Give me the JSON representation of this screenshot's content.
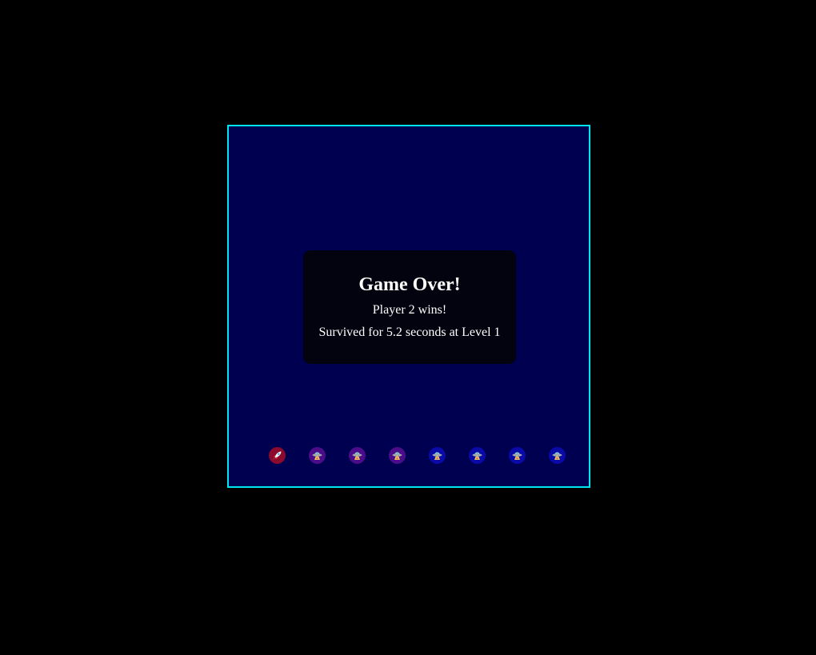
{
  "overlay": {
    "title": "Game Over!",
    "winner": "Player 2 wins!",
    "summary_prefix": "Survived for",
    "survival_seconds": "5.2",
    "summary_mid": "seconds at",
    "level_label": "Level",
    "level": "1"
  },
  "colors": {
    "page_background": "#000000",
    "board_background": "#000050",
    "board_border": "#00e5ee",
    "dialog_background": "#03030f",
    "text": "#ffffff",
    "rocket_badge": "#8b0a2e",
    "alien_badge_purple": "#4b0c8a",
    "alien_badge_blue": "#0a0aa8"
  },
  "sprites": [
    {
      "kind": "rocket",
      "icon": "rocket-icon",
      "badge": "red"
    },
    {
      "kind": "alien",
      "icon": "ufo-alien-icon",
      "badge": "purple"
    },
    {
      "kind": "alien",
      "icon": "ufo-alien-icon",
      "badge": "purple"
    },
    {
      "kind": "alien",
      "icon": "ufo-alien-icon",
      "badge": "purple"
    },
    {
      "kind": "alien",
      "icon": "ufo-alien-icon",
      "badge": "blue"
    },
    {
      "kind": "alien",
      "icon": "ufo-alien-icon",
      "badge": "blue"
    },
    {
      "kind": "alien",
      "icon": "ufo-alien-icon",
      "badge": "blue"
    },
    {
      "kind": "alien",
      "icon": "ufo-alien-icon",
      "badge": "blue"
    }
  ]
}
